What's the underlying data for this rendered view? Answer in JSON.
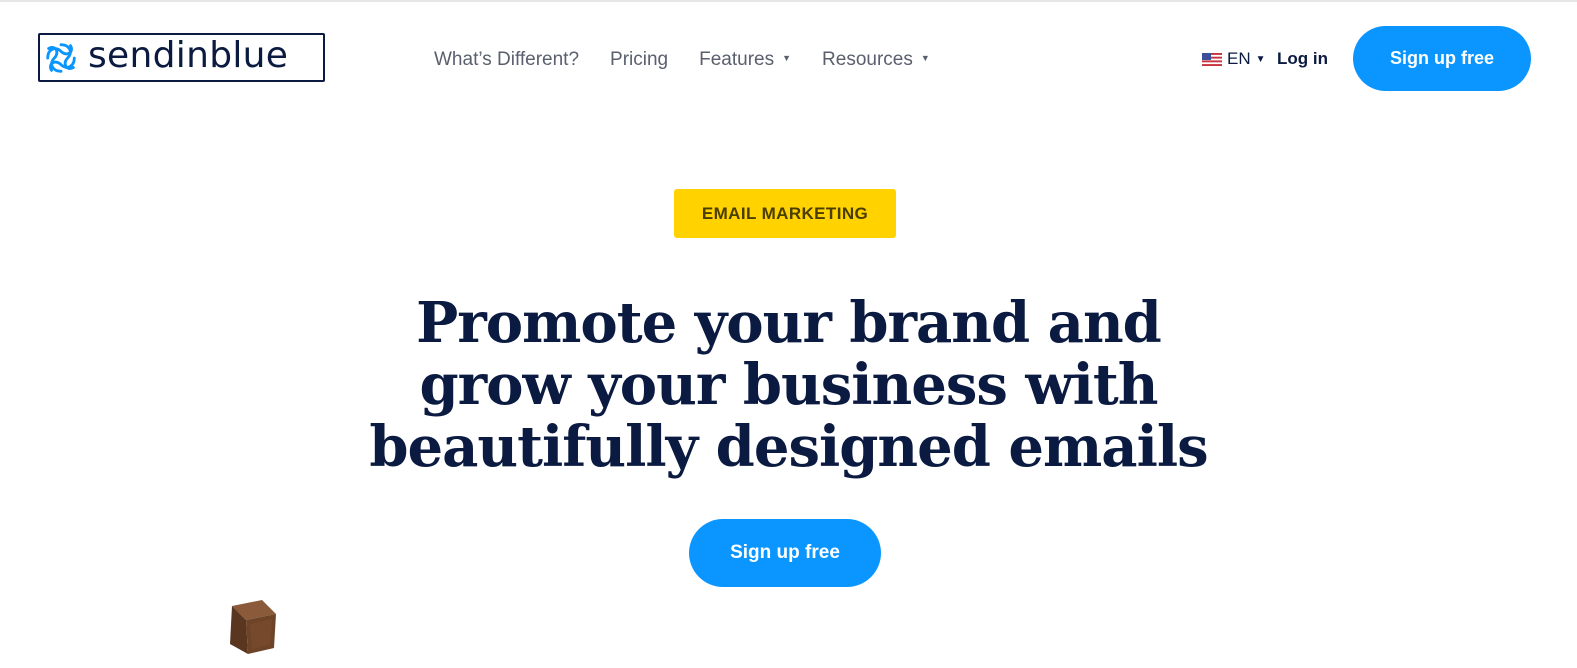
{
  "header": {
    "logo_text": "sendinblue",
    "nav": [
      {
        "label": "What’s Different?",
        "has_dropdown": false
      },
      {
        "label": "Pricing",
        "has_dropdown": false
      },
      {
        "label": "Features",
        "has_dropdown": true
      },
      {
        "label": "Resources",
        "has_dropdown": true
      }
    ],
    "language": {
      "label": "EN",
      "flag_icon": "us-flag-icon"
    },
    "login_label": "Log in",
    "signup_label": "Sign up free"
  },
  "hero": {
    "badge": "EMAIL MARKETING",
    "headline_lines": [
      "Promote your brand and",
      "grow your business with",
      "beautifully designed emails"
    ],
    "cta_label": "Sign up free"
  },
  "colors": {
    "brand_navy": "#0b1a40",
    "primary_blue": "#0b96ff",
    "badge_yellow": "#ffd200",
    "nav_gray": "#5a5f6e"
  }
}
